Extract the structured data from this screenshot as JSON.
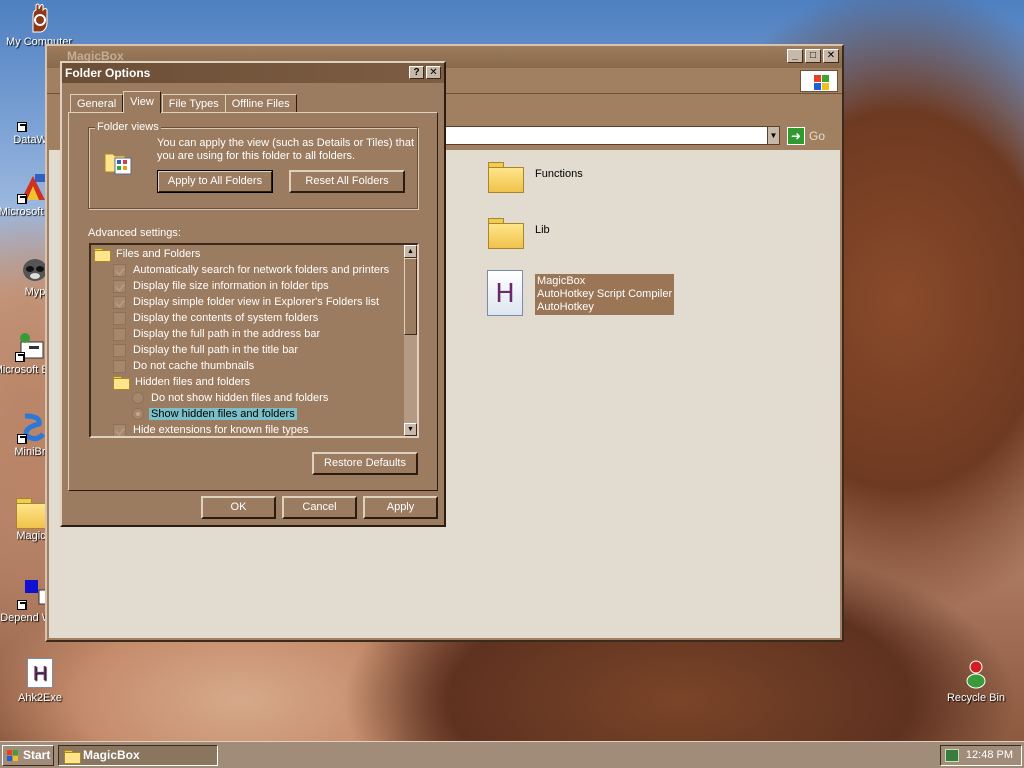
{
  "desktop": {
    "icons": [
      {
        "id": "my-computer",
        "label": "My Computer"
      },
      {
        "id": "datawa",
        "label": "DataWa"
      },
      {
        "id": "microsoft-cpp",
        "label": "Microsoft C++"
      },
      {
        "id": "myp",
        "label": "Myp"
      },
      {
        "id": "microsoft-basic",
        "label": "Microsoft Basic"
      },
      {
        "id": "minibro",
        "label": "MiniBro"
      },
      {
        "id": "magic",
        "label": "Magic"
      },
      {
        "id": "depend-walk",
        "label": "Depend Walk"
      },
      {
        "id": "ahk2exe",
        "label": "Ahk2Exe"
      },
      {
        "id": "recycle-bin",
        "label": "Recycle Bin"
      }
    ]
  },
  "explorer": {
    "title": "MagicBox",
    "go_label": "Go",
    "files": [
      {
        "name": "Functions",
        "type": "folder"
      },
      {
        "name": "Lib",
        "type": "folder"
      },
      {
        "name_lines": [
          "MagicBox",
          "AutoHotkey Script Compiler",
          "AutoHotkey"
        ],
        "type": "ahk",
        "icon_letter": "H"
      }
    ]
  },
  "dialog": {
    "title": "Folder Options",
    "help_btn": "?",
    "close_btn": "✕",
    "tabs": [
      "General",
      "View",
      "File Types",
      "Offline Files"
    ],
    "active_tab": "View",
    "folder_views": {
      "legend": "Folder views",
      "description": "You can apply the view (such as Details or Tiles) that you are using for this folder to all folders.",
      "apply_all": "Apply to All Folders",
      "reset_all": "Reset All Folders"
    },
    "advanced_label": "Advanced settings:",
    "tree": [
      {
        "kind": "folder",
        "label": "Files and Folders",
        "indent": 0
      },
      {
        "kind": "check",
        "label": "Automatically search for network folders and printers",
        "checked": true,
        "indent": 1
      },
      {
        "kind": "check",
        "label": "Display file size information in folder tips",
        "checked": true,
        "indent": 1
      },
      {
        "kind": "check",
        "label": "Display simple folder view in Explorer's Folders list",
        "checked": true,
        "indent": 1
      },
      {
        "kind": "check",
        "label": "Display the contents of system folders",
        "checked": false,
        "indent": 1
      },
      {
        "kind": "check",
        "label": "Display the full path in the address bar",
        "checked": false,
        "indent": 1
      },
      {
        "kind": "check",
        "label": "Display the full path in the title bar",
        "checked": false,
        "indent": 1
      },
      {
        "kind": "check",
        "label": "Do not cache thumbnails",
        "checked": false,
        "indent": 1
      },
      {
        "kind": "folder",
        "label": "Hidden files and folders",
        "indent": 1
      },
      {
        "kind": "radio",
        "label": "Do not show hidden files and folders",
        "checked": false,
        "indent": 2
      },
      {
        "kind": "radio",
        "label": "Show hidden files and folders",
        "checked": true,
        "indent": 2,
        "selected": true
      },
      {
        "kind": "check",
        "label": "Hide extensions for known file types",
        "checked": true,
        "indent": 1
      }
    ],
    "restore_defaults": "Restore Defaults",
    "ok": "OK",
    "cancel": "Cancel",
    "apply": "Apply"
  },
  "taskbar": {
    "start_label": "Start",
    "task_label": "MagicBox",
    "clock": "12:48 PM"
  }
}
